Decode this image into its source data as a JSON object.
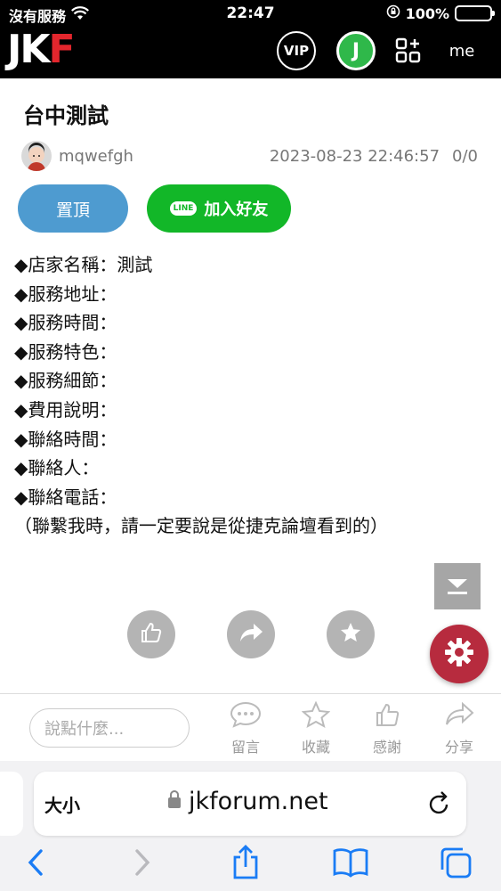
{
  "status_bar": {
    "carrier": "沒有服務",
    "time": "22:47",
    "battery": "100%"
  },
  "header": {
    "logo_left": "JK",
    "logo_right": "F",
    "vip_label": "VIP",
    "j_label": "J",
    "me_label": "me"
  },
  "post": {
    "title": "台中測試",
    "author": "mqwefgh",
    "datetime": "2023-08-23 22:46:57",
    "counter": "0/0",
    "pin_label": "置頂",
    "line_badge": "LINE",
    "line_label": "加入好友",
    "lines": [
      "◆店家名稱：測試",
      "◆服務地址：",
      "◆服務時間：",
      "◆服務特色：",
      "◆服務細節：",
      "◆費用說明：",
      "◆聯絡時間：",
      "◆聯絡人：",
      "◆聯絡電話：",
      "（聯繫我時，請一定要說是從捷克論壇看到的）"
    ]
  },
  "reply_bar": {
    "placeholder": "說點什麼...",
    "actions": [
      "留言",
      "收藏",
      "感謝",
      "分享"
    ]
  },
  "safari": {
    "aa_label": "大小",
    "url": "jkforum.net"
  },
  "colors": {
    "pin_blue": "#4e9bd0",
    "line_green": "#12b728",
    "gear_red": "#b72b3e",
    "logo_red": "#e3262d"
  }
}
